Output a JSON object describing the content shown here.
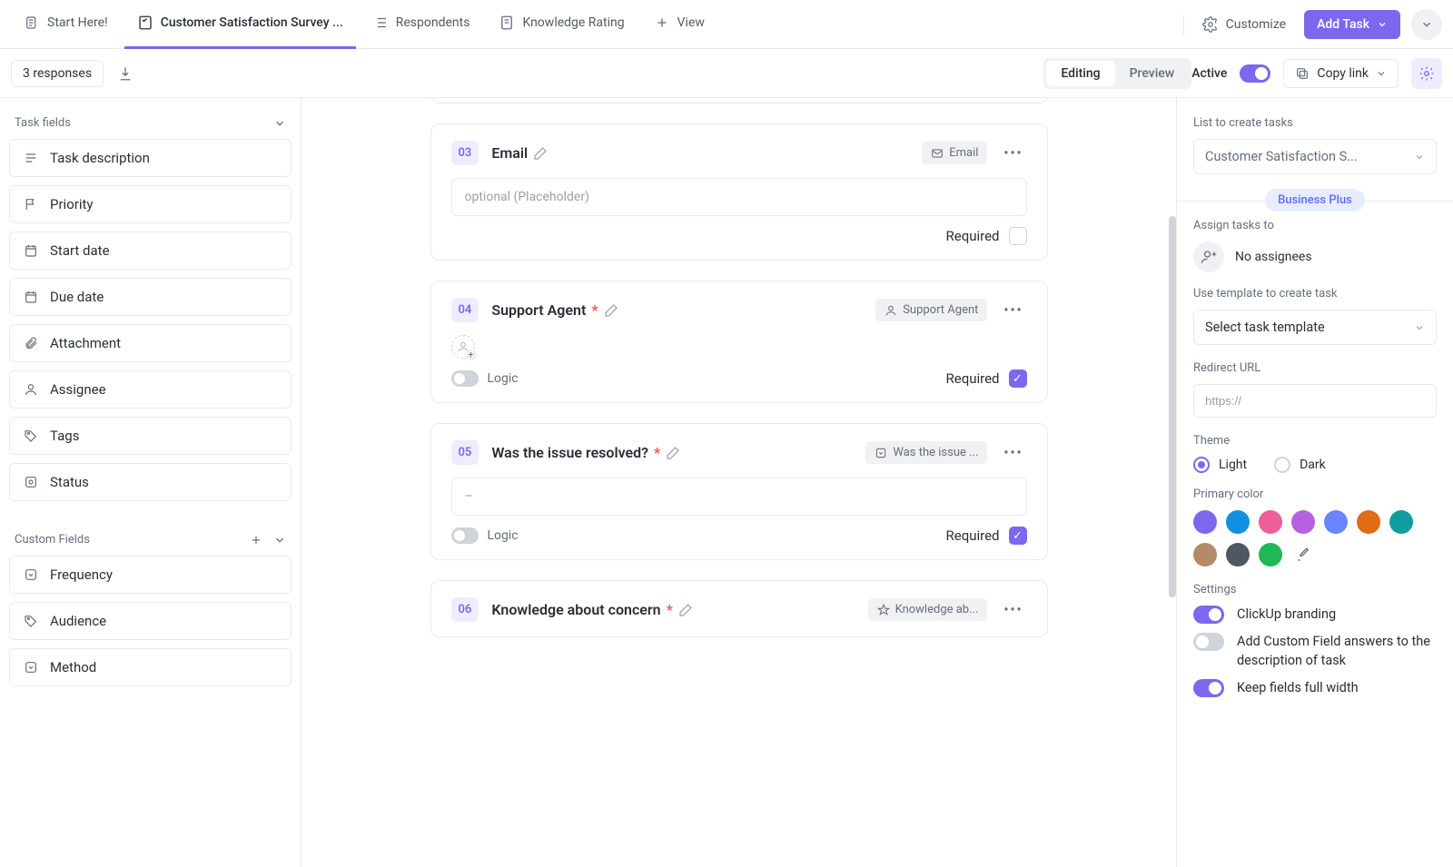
{
  "topbar": {
    "start_here": "Start Here!",
    "active_tab": "Customer Satisfaction Survey ...",
    "respondents": "Respondents",
    "knowledge_rating": "Knowledge Rating",
    "view": "View",
    "customize": "Customize",
    "add_task": "Add Task"
  },
  "subbar": {
    "responses": "3 responses",
    "editing": "Editing",
    "preview": "Preview",
    "active": "Active",
    "copy_link": "Copy link"
  },
  "left": {
    "task_fields": "Task fields",
    "items": [
      {
        "label": "Task description"
      },
      {
        "label": "Priority"
      },
      {
        "label": "Start date"
      },
      {
        "label": "Due date"
      },
      {
        "label": "Attachment"
      },
      {
        "label": "Assignee"
      },
      {
        "label": "Tags"
      },
      {
        "label": "Status"
      }
    ],
    "custom_fields": "Custom Fields",
    "custom": [
      {
        "label": "Frequency"
      },
      {
        "label": "Audience"
      },
      {
        "label": "Method"
      }
    ]
  },
  "cards": {
    "required": "Required",
    "logic": "Logic",
    "placeholder_text": "optional (Placeholder)",
    "dash": "–",
    "q3": {
      "num": "03",
      "title": "Email",
      "pill": "Email"
    },
    "q4": {
      "num": "04",
      "title": "Support Agent",
      "pill": "Support Agent"
    },
    "q5": {
      "num": "05",
      "title": "Was the issue resolved?",
      "pill": "Was the issue ..."
    },
    "q6": {
      "num": "06",
      "title": "Knowledge about concern",
      "pill": "Knowledge ab..."
    }
  },
  "right": {
    "list_label": "List to create tasks",
    "list_value": "Customer Satisfaction S...",
    "business_plus": "Business Plus",
    "assign_label": "Assign tasks to",
    "no_assignees": "No assignees",
    "template_label": "Use template to create task",
    "template_value": "Select task template",
    "redirect_label": "Redirect URL",
    "redirect_placeholder": "https://",
    "theme_label": "Theme",
    "light": "Light",
    "dark": "Dark",
    "primary_color_label": "Primary color",
    "colors": [
      "#7b68ee",
      "#1090e0",
      "#ee5e99",
      "#b660e0",
      "#6985ff",
      "#e16b16",
      "#0f9d9f",
      "#b38a6a",
      "#4f5762",
      "#1db954"
    ],
    "settings_label": "Settings",
    "settings": {
      "branding": "ClickUp branding",
      "add_cf_desc": "Add Custom Field answers to the description of task",
      "full_width": "Keep fields full width"
    }
  }
}
